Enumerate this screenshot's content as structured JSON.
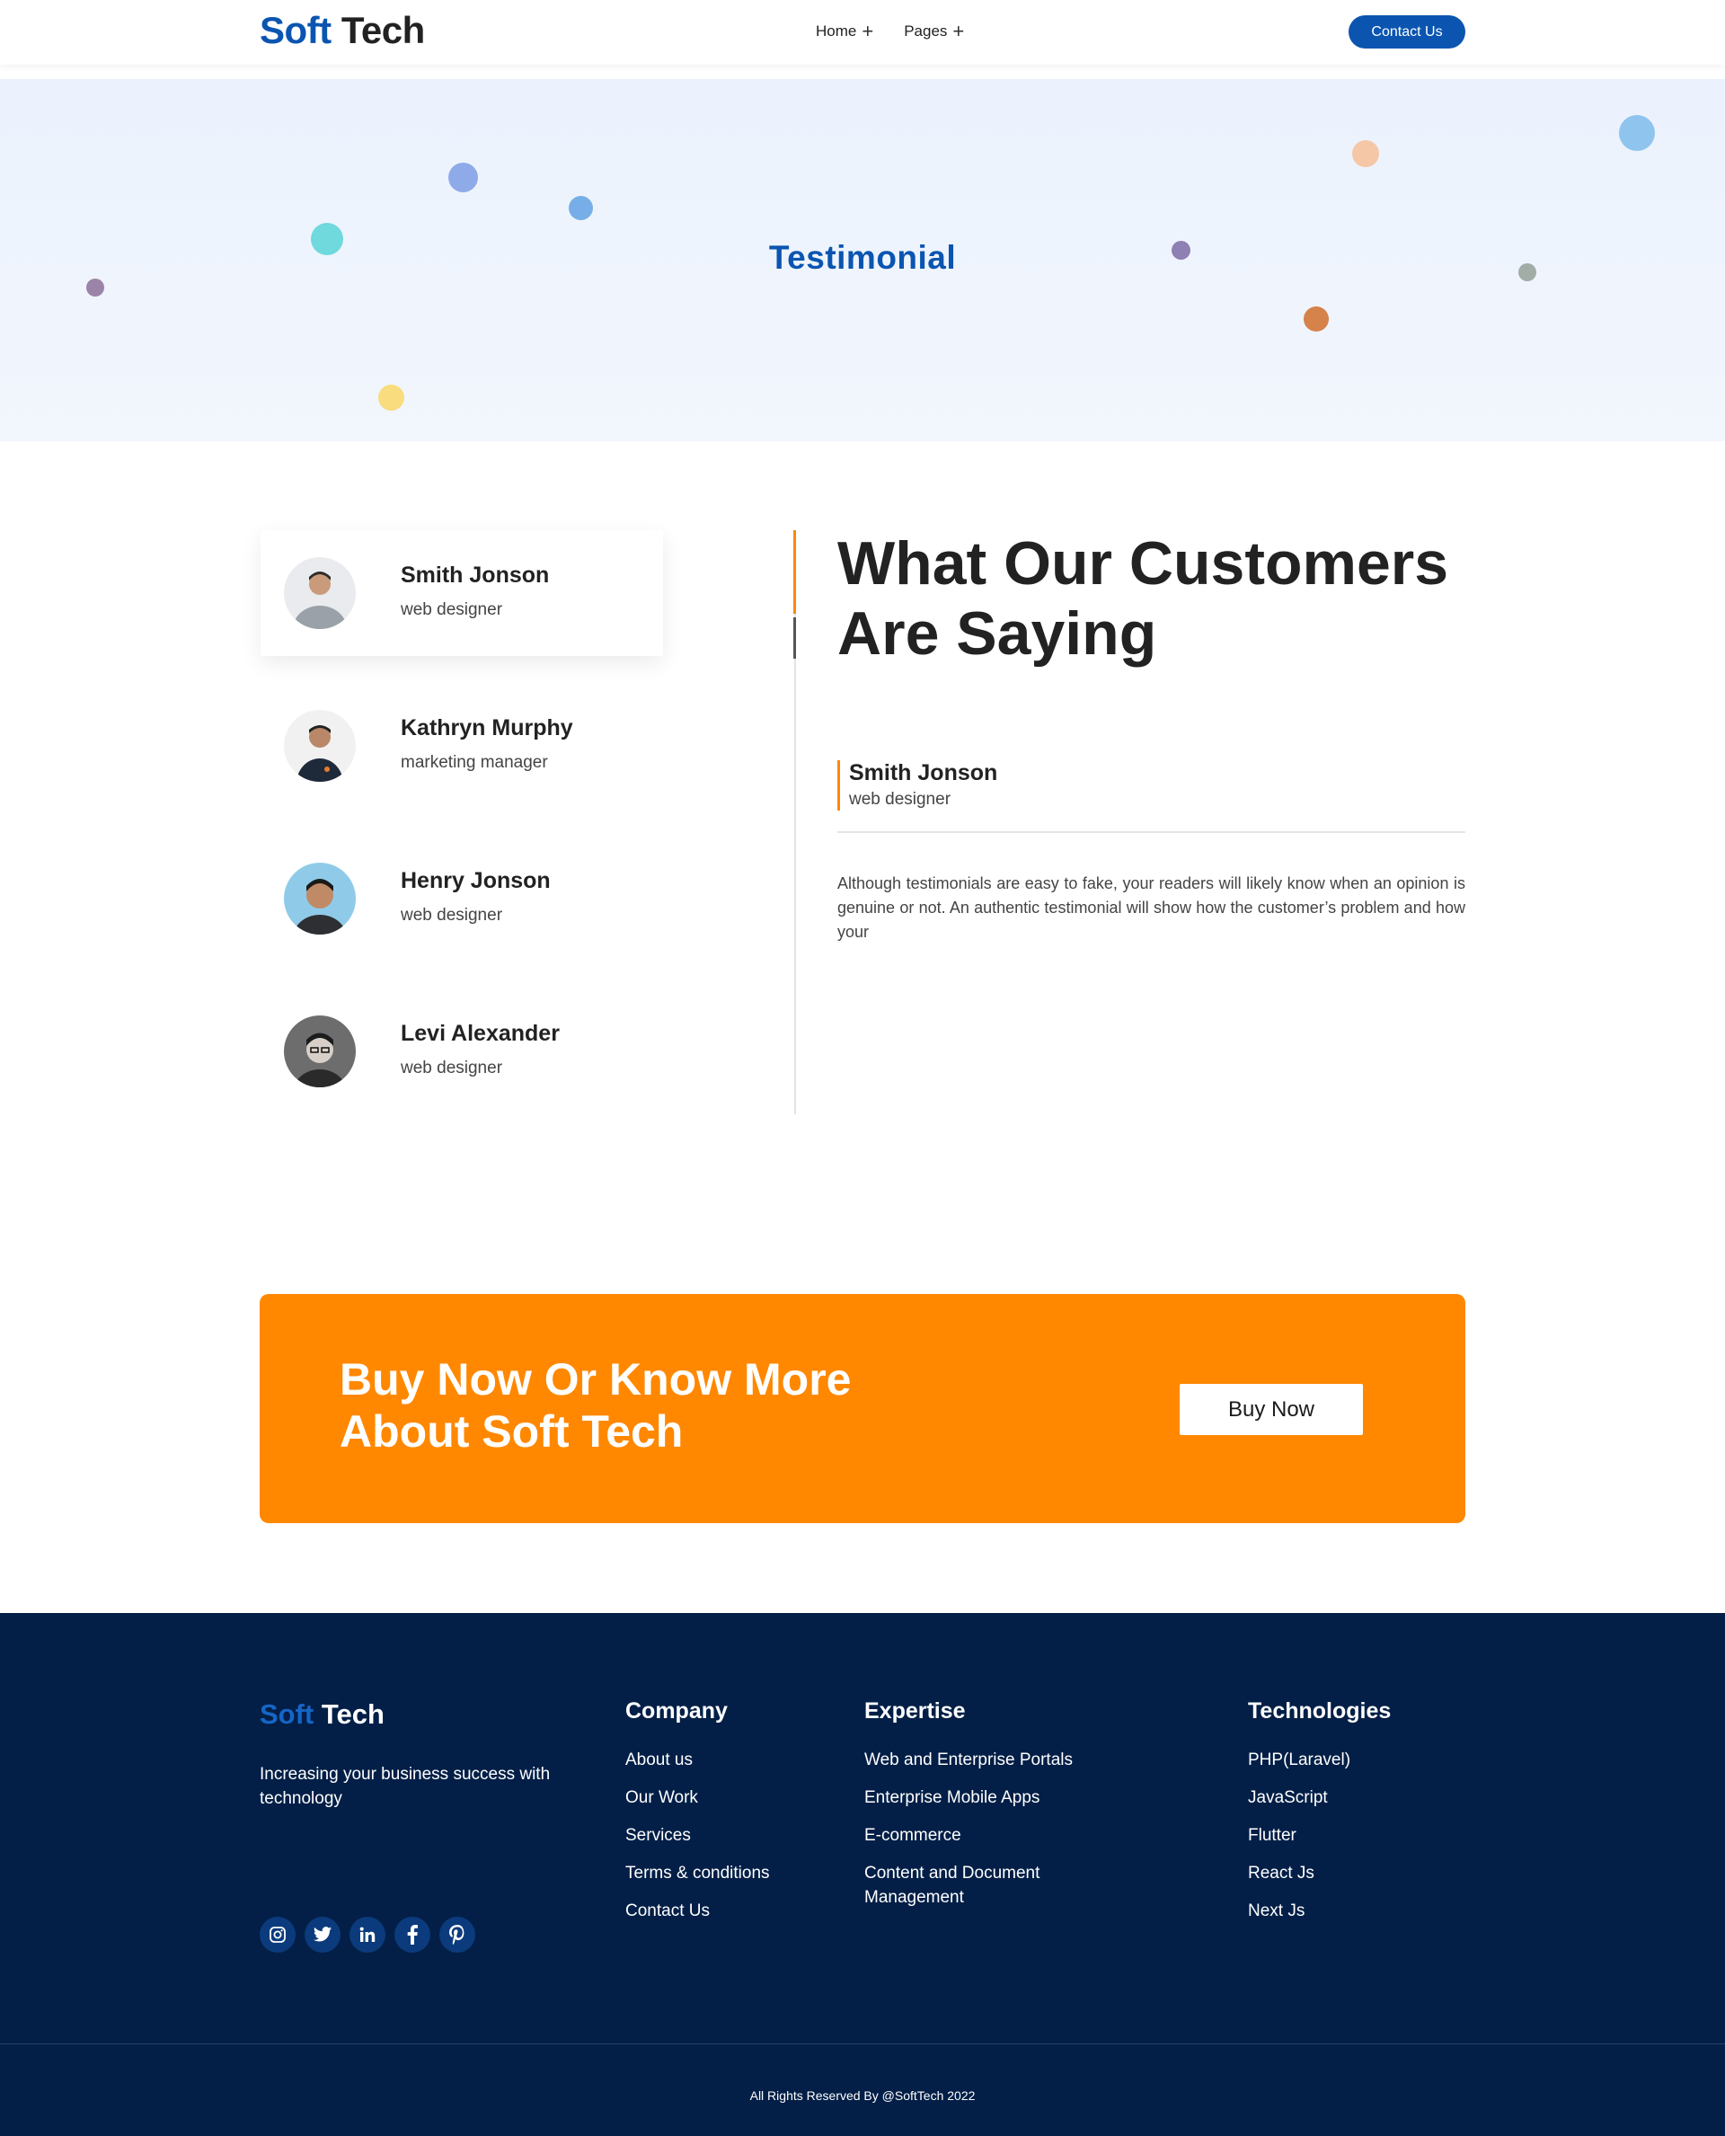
{
  "header": {
    "logo_soft": "Soft",
    "logo_tech": "Tech",
    "nav": [
      {
        "label": "Home",
        "icon": "plus-icon"
      },
      {
        "label": "Pages",
        "icon": "plus-icon"
      }
    ],
    "contact_label": "Contact Us"
  },
  "hero": {
    "title": "Testimonial"
  },
  "testimonials": {
    "people": [
      {
        "name": "Smith Jonson",
        "role": "web designer",
        "active": true
      },
      {
        "name": "Kathryn Murphy",
        "role": "marketing manager",
        "active": false
      },
      {
        "name": "Henry Jonson",
        "role": "web designer",
        "active": false
      },
      {
        "name": "Levi Alexander",
        "role": "web designer",
        "active": false
      }
    ],
    "heading": "What Our Customers Are Saying",
    "selected": {
      "name": "Smith Jonson",
      "role": "web designer",
      "quote": "Although testimonials are easy to fake, your readers will likely know when an opinion is genuine or not. An authentic testimonial will show how the customer’s problem and how your"
    }
  },
  "cta": {
    "title": "Buy Now Or Know More About Soft Tech",
    "button": "Buy Now"
  },
  "footer": {
    "logo_soft": "Soft",
    "logo_tech": "Tech",
    "tagline": "Increasing your business success with technology",
    "socials": [
      "instagram-icon",
      "twitter-icon",
      "linkedin-icon",
      "facebook-icon",
      "pinterest-icon"
    ],
    "company": {
      "title": "Company",
      "links": [
        "About us",
        "Our Work",
        "Services",
        "Terms & conditions",
        "Contact Us"
      ]
    },
    "expertise": {
      "title": "Expertise",
      "links": [
        "Web and Enterprise Portals",
        "Enterprise Mobile Apps",
        "E-commerce",
        "Content and Document Management"
      ]
    },
    "technologies": {
      "title": "Technologies",
      "links": [
        "PHP(Laravel)",
        "JavaScript",
        "Flutter",
        "React Js",
        "Next Js"
      ]
    },
    "copyright": "All Rights Reserved By @SoftTech 2022"
  },
  "colors": {
    "brand_blue": "#0b55b0",
    "accent_orange": "#ff8800",
    "footer_navy": "#031f47"
  }
}
